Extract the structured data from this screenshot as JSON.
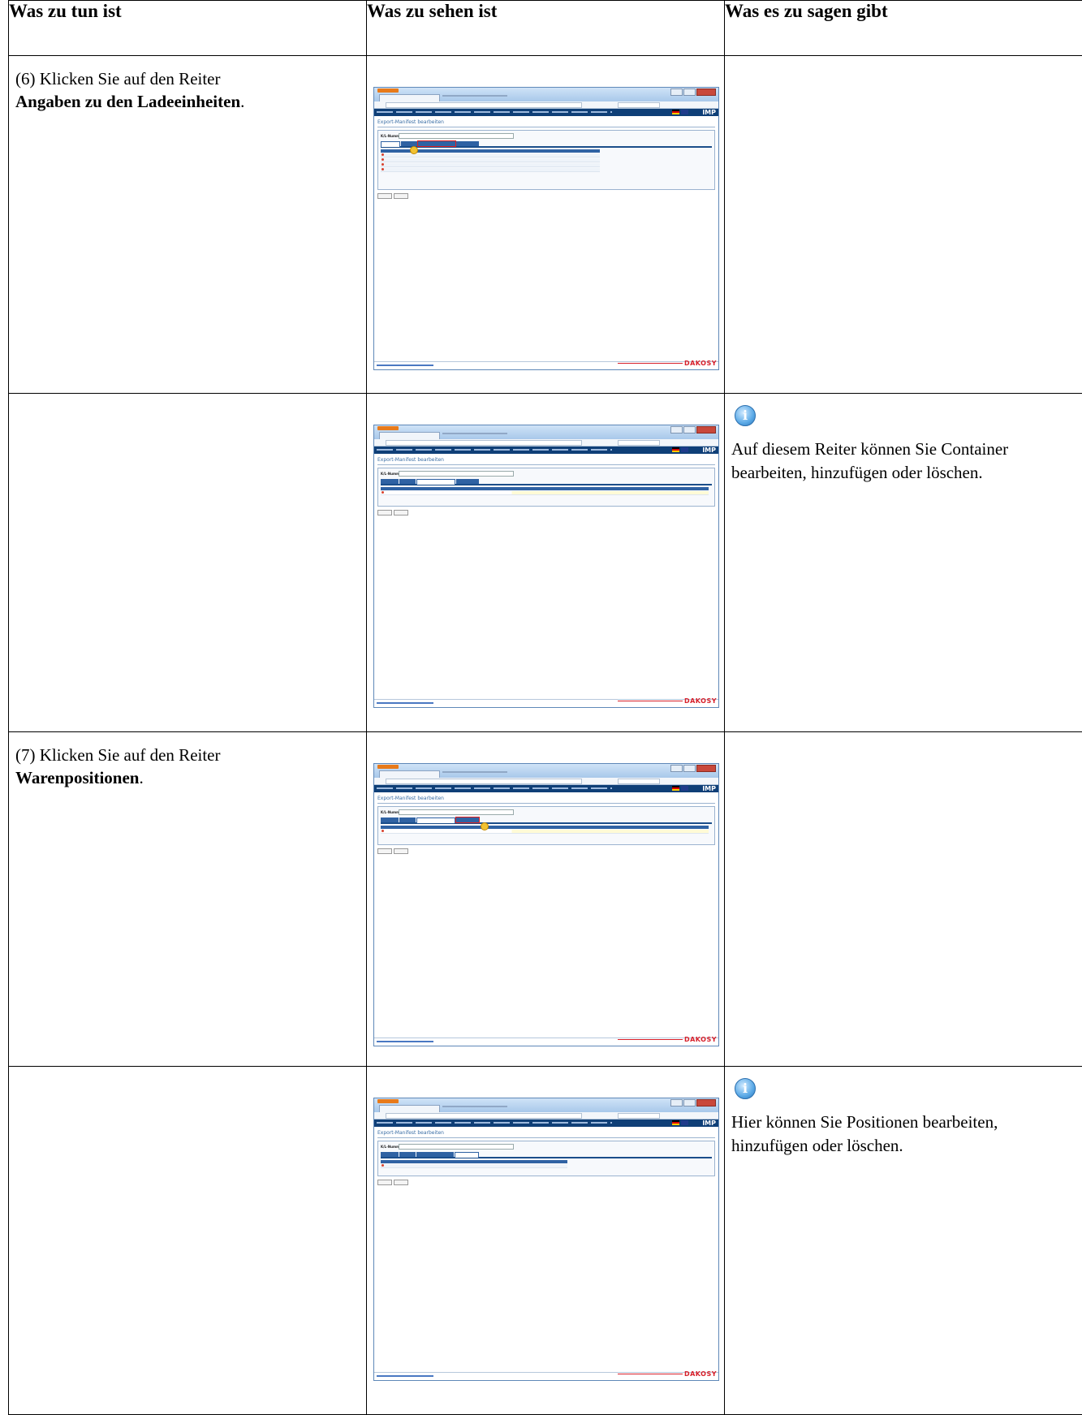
{
  "headers": {
    "col1": "Was zu tun ist",
    "col2": "Was zu sehen ist",
    "col3": "Was es zu sagen gibt"
  },
  "rows": [
    {
      "step_prefix": "(6) Klicken Sie auf den Reiter",
      "step_bold": "Angaben zu den Ladeeinheiten",
      "step_suffix": ".",
      "note": ""
    },
    {
      "step_prefix": "",
      "step_bold": "",
      "step_suffix": "",
      "note": "Auf diesem Reiter können Sie Container bearbeiten, hinzufügen oder löschen."
    },
    {
      "step_prefix": "(7) Klicken Sie auf den Reiter",
      "step_bold": "Warenpositionen",
      "step_suffix": ".",
      "note": ""
    },
    {
      "step_prefix": "",
      "step_bold": "",
      "step_suffix": "",
      "note": "Hier können Sie Positionen bearbeiten, hinzufügen oder löschen."
    }
  ],
  "screenshot": {
    "page_title": "Export-Manifest bearbeiten",
    "ks_label": "K/L-Nummer:",
    "logo": "IMP",
    "brand": "DAKOSY"
  },
  "icons": {
    "info": "info-icon"
  }
}
